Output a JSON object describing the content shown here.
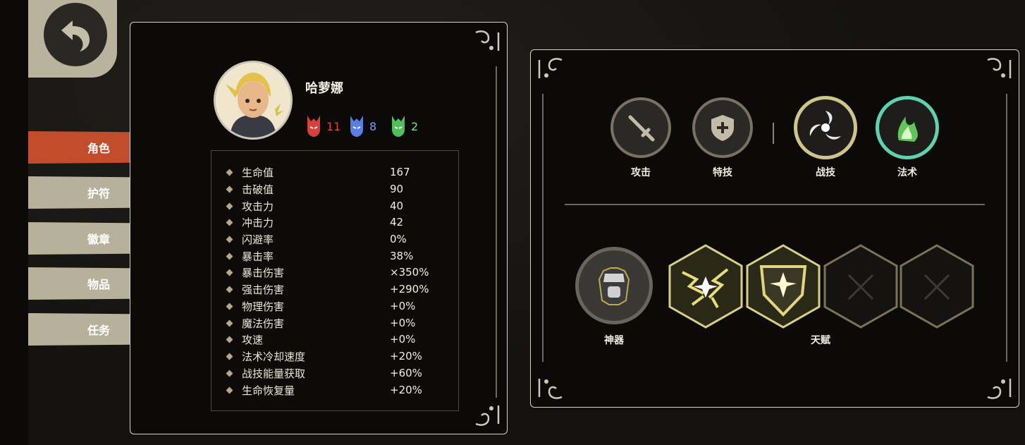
{
  "back_button": {
    "icon": "back-arrow-icon"
  },
  "nav_tabs": [
    {
      "label": "角色",
      "active": true
    },
    {
      "label": "护符",
      "active": false
    },
    {
      "label": "徽章",
      "active": false
    },
    {
      "label": "物品",
      "active": false
    },
    {
      "label": "任务",
      "active": false
    }
  ],
  "character": {
    "name": "哈萝娜",
    "resources": [
      {
        "icon": "red-mask-icon",
        "value": "11",
        "color": "#e0453b"
      },
      {
        "icon": "blue-mask-icon",
        "value": "8",
        "color": "#6d8ff0"
      },
      {
        "icon": "green-mask-icon",
        "value": "2",
        "color": "#79d77a"
      }
    ]
  },
  "stats": [
    {
      "label": "生命值",
      "value": "167"
    },
    {
      "label": "击破值",
      "value": "90"
    },
    {
      "label": "攻击力",
      "value": "40"
    },
    {
      "label": "冲击力",
      "value": "42"
    },
    {
      "label": "闪避率",
      "value": "0%"
    },
    {
      "label": "暴击率",
      "value": "38%"
    },
    {
      "label": "暴击伤害",
      "value": "×350%"
    },
    {
      "label": "强击伤害",
      "value": "+290%"
    },
    {
      "label": "物理伤害",
      "value": "+0%"
    },
    {
      "label": "魔法伤害",
      "value": "+0%"
    },
    {
      "label": "攻速",
      "value": "+0%"
    },
    {
      "label": "法术冷却速度",
      "value": "+20%"
    },
    {
      "label": "战技能量获取",
      "value": "+60%"
    },
    {
      "label": "生命恢复量",
      "value": "+20%"
    }
  ],
  "skills": [
    {
      "label": "攻击",
      "icon": "sword-icon"
    },
    {
      "label": "特技",
      "icon": "shield-plus-icon"
    },
    {
      "label": "战技",
      "icon": "tri-swirl-icon"
    },
    {
      "label": "法术",
      "icon": "green-flame-icon"
    }
  ],
  "artifact": {
    "label": "神器",
    "icon": "armor-artifact-icon"
  },
  "talents": {
    "label": "天赋",
    "slots": [
      {
        "icon": "lightning-star-talent-icon",
        "filled": true
      },
      {
        "icon": "shield-star-talent-icon",
        "filled": true
      },
      {
        "icon": "empty-slot-icon",
        "filled": false
      },
      {
        "icon": "empty-slot-icon",
        "filled": false
      }
    ]
  },
  "colors": {
    "accent_tab": "#c9502e",
    "tab": "#b9b29c",
    "gold": "#d4c870"
  }
}
